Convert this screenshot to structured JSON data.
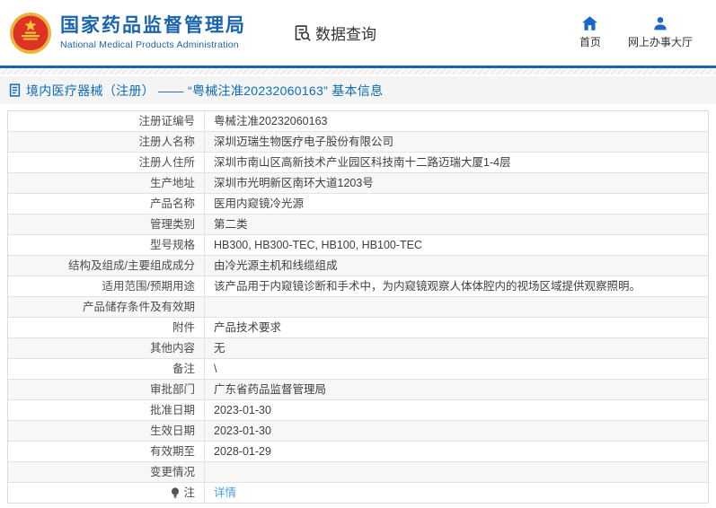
{
  "header": {
    "brand": {
      "title": "国家药品监督管理局",
      "subtitle": "National Medical Products Administration"
    },
    "query_label": "数据查询",
    "nav": {
      "home": "首页",
      "hall": "网上办事大厅"
    }
  },
  "page_title": "境内医疗器械（注册） —— “粤械注准20232060163” 基本信息",
  "colors": {
    "brand_blue": "#1a64ad",
    "icon_blue": "#1f66c9",
    "title_blue": "#0e6cb8",
    "link_blue": "#4da0e8",
    "alt_row_bg": "#f7f7f7",
    "title_bar_bg": "#f4f4f4"
  },
  "table": {
    "rows": [
      {
        "label": "注册证编号",
        "value": "粤械注准20232060163"
      },
      {
        "label": "注册人名称",
        "value": "深圳迈瑞生物医疗电子股份有限公司"
      },
      {
        "label": "注册人住所",
        "value": "深圳市南山区高新技术产业园区科技南十二路迈瑞大厦1-4层"
      },
      {
        "label": "生产地址",
        "value": "深圳市光明新区南环大道1203号"
      },
      {
        "label": "产品名称",
        "value": "医用内窥镜冷光源"
      },
      {
        "label": "管理类别",
        "value": "第二类"
      },
      {
        "label": "型号规格",
        "value": "HB300, HB300-TEC, HB100, HB100-TEC"
      },
      {
        "label": "结构及组成/主要组成成分",
        "value": "由冷光源主机和线缆组成"
      },
      {
        "label": "适用范围/预期用途",
        "value": "该产品用于内窥镜诊断和手术中，为内窥镜观察人体体腔内的视场区域提供观察照明。"
      },
      {
        "label": "产品储存条件及有效期",
        "value": ""
      },
      {
        "label": "附件",
        "value": "产品技术要求"
      },
      {
        "label": "其他内容",
        "value": "无"
      },
      {
        "label": "备注",
        "value": "\\"
      },
      {
        "label": "审批部门",
        "value": "广东省药品监督管理局"
      },
      {
        "label": "批准日期",
        "value": "2023-01-30"
      },
      {
        "label": "生效日期",
        "value": "2023-01-30"
      },
      {
        "label": "有效期至",
        "value": "2028-01-29"
      },
      {
        "label": "变更情况",
        "value": ""
      },
      {
        "label": "注",
        "value": "详情",
        "link": true,
        "icon": "lightbulb"
      }
    ]
  }
}
